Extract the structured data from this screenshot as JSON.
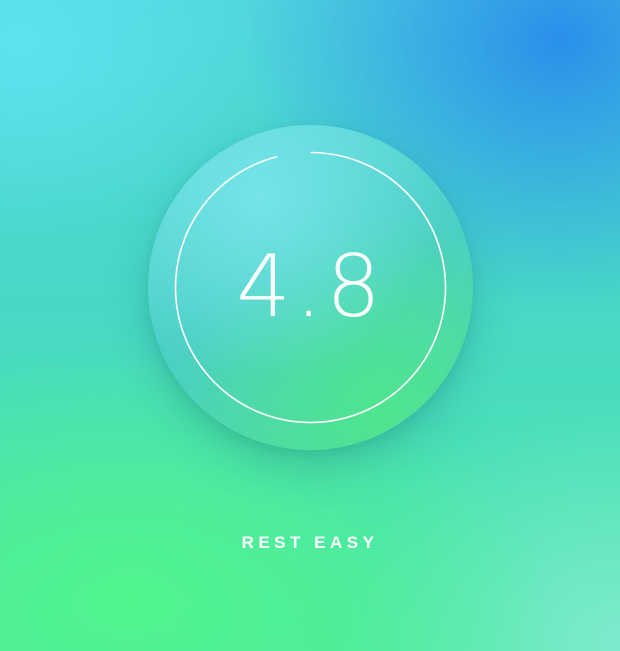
{
  "screen": {
    "rating_value": "4.8",
    "rating_fraction": 0.96,
    "caption": "REST EASY"
  },
  "colors": {
    "text": "#ffffff",
    "gradient_top_right": "#288ceb",
    "gradient_bottom_left": "#50f58c",
    "dial_fill": "#4ccfc5"
  }
}
